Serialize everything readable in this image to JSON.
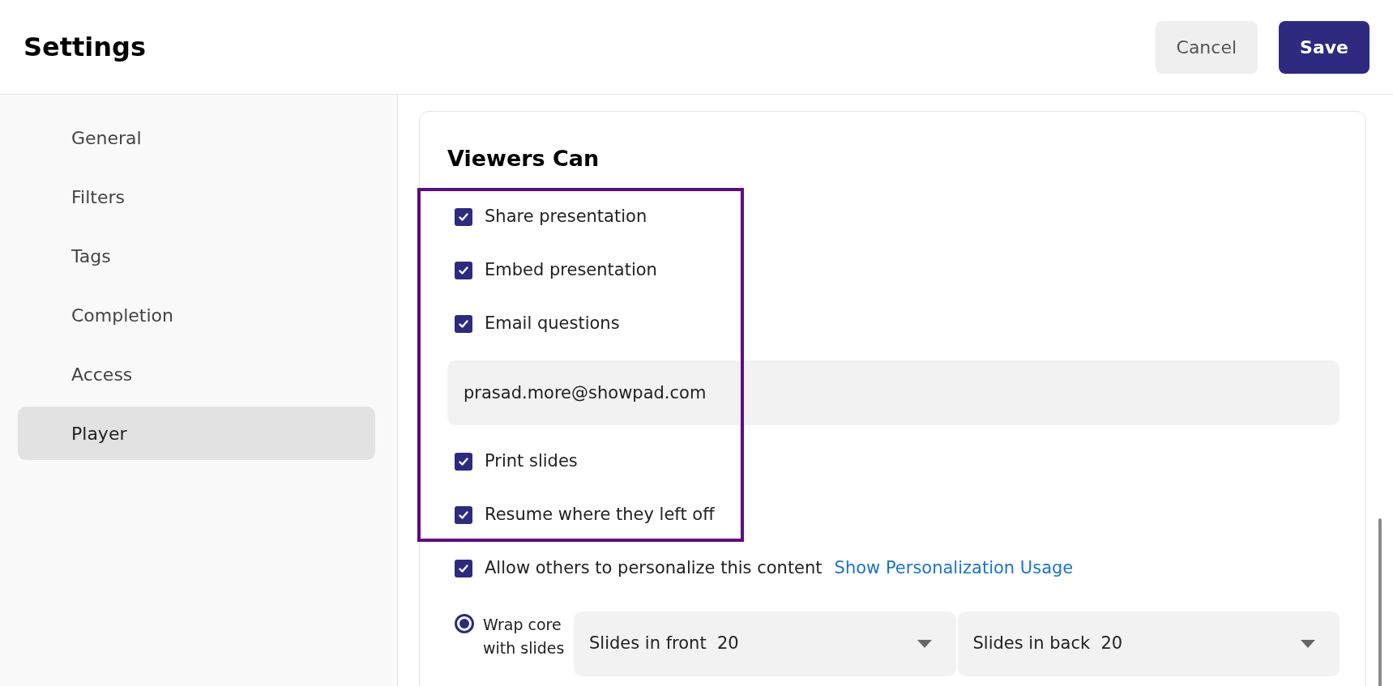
{
  "header": {
    "title": "Settings",
    "buttons": [
      {
        "label": "Cancel",
        "kind": "secondary"
      },
      {
        "label": "Save",
        "kind": "primary"
      }
    ]
  },
  "sidebar": {
    "items": [
      {
        "label": "General",
        "selected": false
      },
      {
        "label": "Filters",
        "selected": false
      },
      {
        "label": "Tags",
        "selected": false
      },
      {
        "label": "Completion",
        "selected": false
      },
      {
        "label": "Access",
        "selected": false
      },
      {
        "label": "Player",
        "selected": true
      }
    ]
  },
  "viewers": {
    "title": "Viewers Can",
    "highlighted_options": [
      {
        "kind": "checkbox",
        "label": "Share presentation",
        "checked": true
      },
      {
        "kind": "checkbox",
        "label": "Embed presentation",
        "checked": true
      },
      {
        "kind": "checkbox",
        "label": "Email questions",
        "checked": true
      },
      {
        "kind": "email_field",
        "value": "prasad.more@showpad.com"
      },
      {
        "kind": "checkbox",
        "label": "Print slides",
        "checked": true
      },
      {
        "kind": "checkbox",
        "label": "Resume where they left off",
        "checked": true
      }
    ],
    "personalize": {
      "label": "Allow others to personalize this content",
      "checked": true,
      "link": "Show Personalization Usage"
    },
    "wrap": {
      "label": "Wrap core with slides",
      "selected": true,
      "selects": [
        {
          "label": "Slides in front",
          "value": "20"
        },
        {
          "label": "Slides in back",
          "value": "20"
        }
      ]
    }
  }
}
